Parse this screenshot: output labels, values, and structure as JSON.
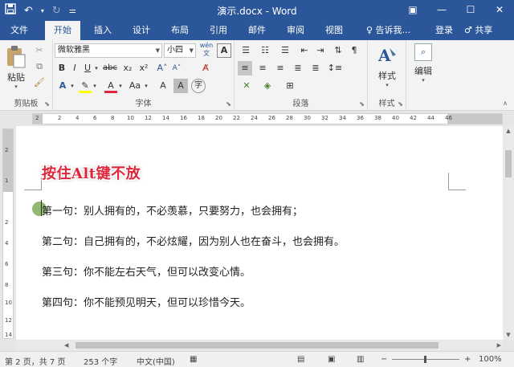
{
  "window": {
    "title": "演示.docx - Word",
    "qat": {
      "save_icon": "save-icon",
      "undo_icon": "undo-icon",
      "redo_icon": "redo-icon"
    }
  },
  "tabs": [
    {
      "label": "文件"
    },
    {
      "label": "开始"
    },
    {
      "label": "插入"
    },
    {
      "label": "设计"
    },
    {
      "label": "布局"
    },
    {
      "label": "引用"
    },
    {
      "label": "邮件"
    },
    {
      "label": "审阅"
    },
    {
      "label": "视图"
    }
  ],
  "tell_me": "♀ 告诉我...",
  "login": "登录",
  "share": "♂ 共享",
  "ribbon": {
    "clipboard": {
      "label": "剪贴板",
      "paste": "粘贴"
    },
    "font": {
      "label": "字体",
      "font_name": "微软雅黑",
      "font_size": "小四",
      "wen": "wén 文",
      "big_a": "A",
      "a_up": "A˄",
      "a_down": "A˅",
      "aa": "Aa",
      "bold": "B",
      "italic": "I",
      "underline": "U",
      "strike": "abc",
      "sub": "x₂",
      "sup": "x²",
      "font_color_a": "A",
      "highlight_a": "A",
      "shade_a": "A"
    },
    "paragraph": {
      "label": "段落"
    },
    "styles": {
      "label": "样式",
      "button": "样式"
    },
    "editing": {
      "button": "编辑"
    }
  },
  "ruler_ticks_h": [
    "2",
    "2",
    "4",
    "6",
    "8",
    "10",
    "12",
    "14",
    "16",
    "18",
    "20",
    "22",
    "24",
    "26",
    "28",
    "30",
    "32",
    "34",
    "36",
    "38",
    "40",
    "42",
    "44",
    "46"
  ],
  "ruler_ticks_v": [
    "2",
    "1",
    "2",
    "4",
    "6",
    "8",
    "10",
    "12",
    "14"
  ],
  "document": {
    "overlay": "按住Alt键不放",
    "lines": [
      "第一句：别人拥有的，不必羡慕，只要努力，也会拥有；",
      "第二句：自己拥有的，不必炫耀，因为别人也在奋斗，也会拥有。",
      "第三句：你不能左右天气，但可以改变心情。",
      "第四句：你不能预见明天，但可以珍惜今天。"
    ]
  },
  "status": {
    "page": "第 2 页，共 7 页",
    "words": "253 个字",
    "lang": "中文(中国)",
    "zoom": "100%"
  },
  "colors": {
    "brand": "#2b579a",
    "overlay": "#e0263b"
  }
}
